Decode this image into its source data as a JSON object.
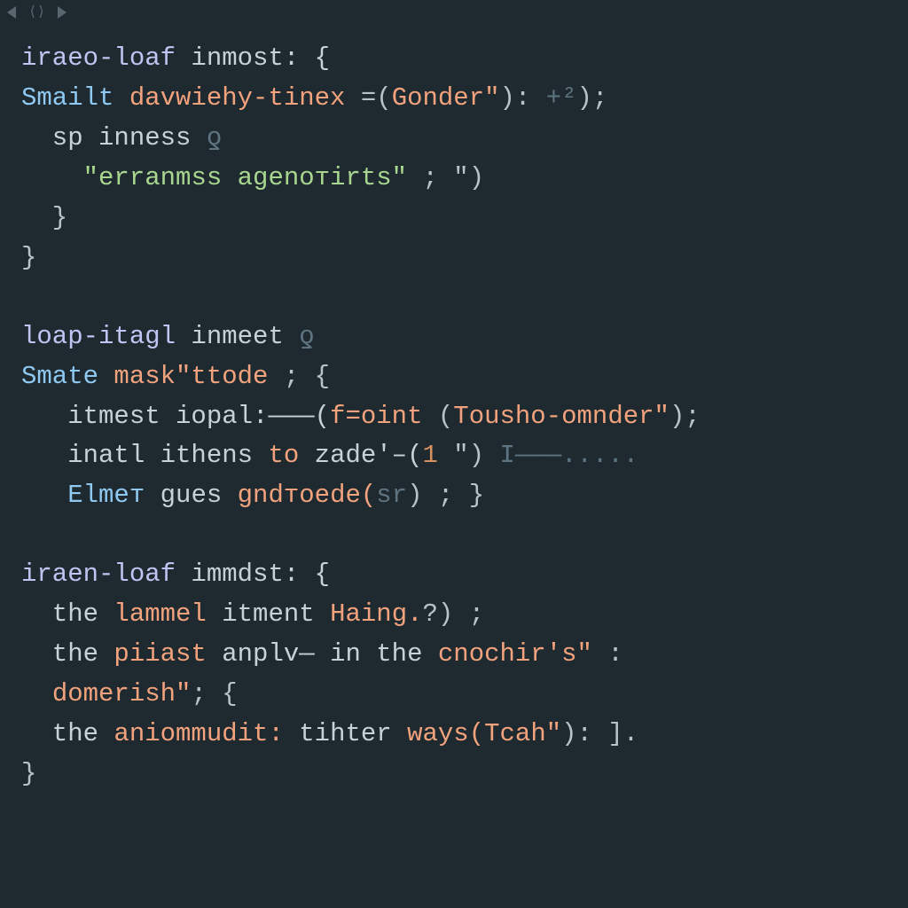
{
  "toolbar": {
    "nav_icon": "⟨⟩"
  },
  "code": {
    "b1": {
      "l1": {
        "a": "iraeo-loaf",
        "b": " inmost: {"
      },
      "l2": {
        "a": "Smailt",
        "b": " dаvwіehy-tіnеx ",
        "c": "=(",
        "d": "Gonder\"",
        "e": "): ",
        "f": "+²",
        "g": ");"
      },
      "l3": {
        "a": "  sp inness ",
        "b": "ƍ"
      },
      "l4": {
        "a": "    ",
        "b": "\"erranmss agenoтirts\"",
        "c": " ; \")"
      },
      "l5": {
        "a": "  }"
      },
      "l6": {
        "a": "}"
      }
    },
    "b2": {
      "l1": {
        "a": "loap-itagl",
        "b": " inmeet ",
        "c": "ƍ"
      },
      "l2": {
        "a": "Smate",
        "b": " mаsk\"ttode ",
        "c": "; {"
      },
      "l3": {
        "a": "   itmest iopal:———(",
        "b": "f=oіnt",
        "c": " (",
        "d": "Тousho-omnder\"",
        "e": ");"
      },
      "l4": {
        "a": "   inatl ithens ",
        "b": "to",
        "c": " zade'–(",
        "d": "1",
        "e": " \") ",
        "f": "I———.....",
        "g": ""
      },
      "l5": {
        "a": "   ",
        "b": "Elmет",
        "c": " gues ",
        "d": "gndтoede(",
        "e": "ѕr",
        "f": ") ; }"
      }
    },
    "b3": {
      "l1": {
        "a": "iraen-loaf",
        "b": " immdst: {"
      },
      "l2": {
        "a": "  the ",
        "b": "lammel",
        "c": " itment ",
        "d": "Hаing.",
        "e": "?) ;"
      },
      "l3": {
        "a": "  the ",
        "b": "pіiast",
        "c": " anplv— in the ",
        "d": "cnochir′s\"",
        "e": " :"
      },
      "l4": {
        "a": "  ",
        "b": "domerish\"",
        "c": "; {"
      },
      "l5": {
        "a": "  the ",
        "b": "anіommudit:",
        "c": " tihter ",
        "d": "ways(",
        "e": "Тcah\"",
        "f": "): ]."
      },
      "l6": {
        "a": "}"
      }
    }
  }
}
